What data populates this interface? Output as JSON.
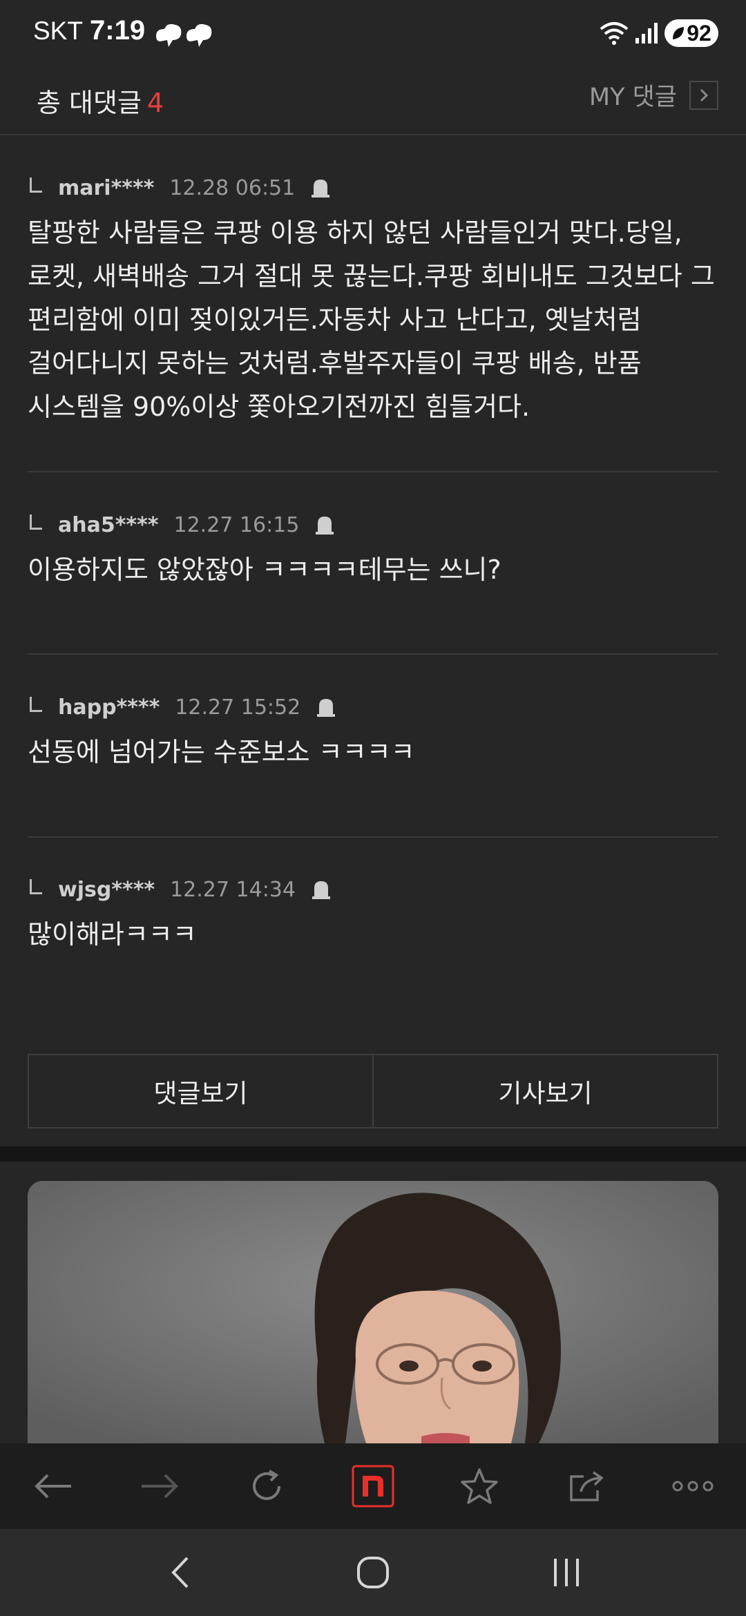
{
  "status_bar": {
    "carrier": "SKT",
    "time": "7:19",
    "battery": "92"
  },
  "header": {
    "title": "총 대댓글",
    "count": "4",
    "my_comments_label": "MY 댓글"
  },
  "comments": [
    {
      "user": "mari****",
      "date": "12.28 06:51",
      "text": "탈팡한 사람들은 쿠팡 이용 하지 않던 사람들인거 맞다.당일, 로켓, 새벽배송 그거 절대 못 끊는다.쿠팡 회비내도 그것보다 그 편리함에 이미 젖이있거든.자동차 사고 난다고, 옛날처럼 걸어다니지 못하는 것처럼.후발주자들이 쿠팡 배송, 반품 시스템을 90%이상 쫓아오기전까진 힘들거다."
    },
    {
      "user": "aha5****",
      "date": "12.27 16:15",
      "text": "이용하지도 않았잖아 ㅋㅋㅋㅋ테무는 쓰니?"
    },
    {
      "user": "happ****",
      "date": "12.27 15:52",
      "text": "선동에 넘어가는 수준보소 ㅋㅋㅋㅋ"
    },
    {
      "user": "wjsg****",
      "date": "12.27 14:34",
      "text": "많이해라ㅋㅋㅋ"
    }
  ],
  "buttons": {
    "view_comments": "댓글보기",
    "view_article": "기사보기"
  },
  "colors": {
    "background": "#262626",
    "accent_count": "#e8403a",
    "naver_red": "#e8302a"
  },
  "icons": {
    "report": "siren-icon",
    "toolbar": [
      "back-arrow-icon",
      "forward-arrow-icon",
      "refresh-icon",
      "naver-home-icon",
      "star-icon",
      "share-icon",
      "more-icon"
    ],
    "nav": [
      "nav-back-icon",
      "nav-home-icon",
      "nav-recents-icon"
    ]
  }
}
